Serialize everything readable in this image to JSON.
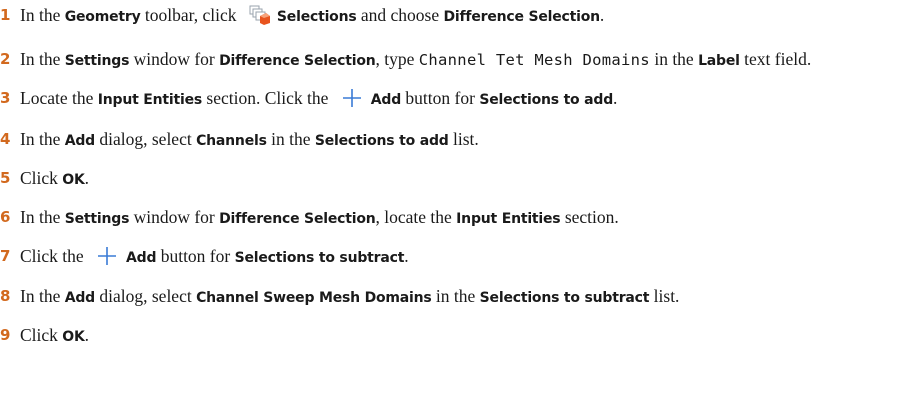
{
  "steps": [
    {
      "num": "1",
      "parts": [
        "In the ",
        "Geometry",
        " toolbar, click ",
        "Selections",
        " and choose ",
        "Difference Selection",
        "."
      ]
    },
    {
      "num": "2",
      "parts": [
        "In the ",
        "Settings",
        " window for ",
        "Difference Selection",
        ", type ",
        "Channel Tet Mesh Domains",
        " in the ",
        "Label",
        " text field."
      ]
    },
    {
      "num": "3",
      "parts": [
        "Locate the ",
        "Input Entities",
        " section. Click the ",
        "Add",
        " button for ",
        "Selections to add",
        "."
      ]
    },
    {
      "num": "4",
      "parts": [
        "In the ",
        "Add",
        " dialog, select ",
        "Channels",
        " in the ",
        "Selections to add",
        " list."
      ]
    },
    {
      "num": "5",
      "parts": [
        "Click ",
        "OK",
        "."
      ]
    },
    {
      "num": "6",
      "parts": [
        "In the ",
        "Settings",
        " window for ",
        "Difference Selection",
        ", locate the ",
        "Input Entities",
        " section."
      ]
    },
    {
      "num": "7",
      "parts": [
        "Click the ",
        "Add",
        " button for ",
        "Selections to subtract",
        "."
      ]
    },
    {
      "num": "8",
      "parts": [
        "In the ",
        "Add",
        " dialog, select ",
        "Channel Sweep Mesh Domains",
        " in the ",
        "Selections to subtract",
        " list."
      ]
    },
    {
      "num": "9",
      "parts": [
        "Click ",
        "OK",
        "."
      ]
    }
  ],
  "icons": {
    "selections": "selections-icon",
    "add": "add-plus-icon"
  },
  "colors": {
    "step_number": "#d2691e",
    "add_icon": "#3a7bd5",
    "selections_icon_accent": "#e8541e"
  }
}
